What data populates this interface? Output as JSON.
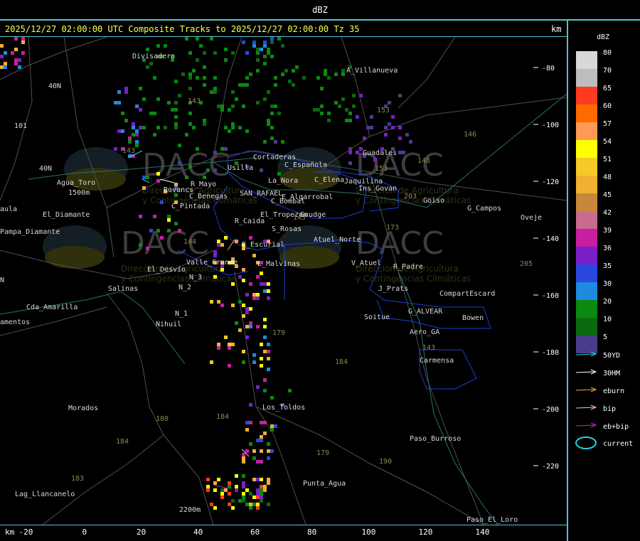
{
  "header": {
    "title": "dBZ"
  },
  "map_title": {
    "text": "2025/12/27 02:00:00 UTC Composite Tracks to 2025/12/27 02:00:00 Tz 35",
    "unit": "km"
  },
  "x_axis": {
    "unit": "km",
    "ticks": [
      "-20",
      "0",
      "20",
      "40",
      "60",
      "80",
      "100",
      "120",
      "140"
    ]
  },
  "y_axis": {
    "ticks": [
      "-80",
      "-100",
      "-120",
      "-140",
      "-160",
      "-180",
      "-200",
      "-220"
    ]
  },
  "legend": {
    "title": "dBZ",
    "scale": [
      {
        "value": "80",
        "color": "#d8d8d8"
      },
      {
        "value": "70",
        "color": "#bdbdbd"
      },
      {
        "value": "65",
        "color": "#ff3a1f"
      },
      {
        "value": "60",
        "color": "#ff6a00"
      },
      {
        "value": "57",
        "color": "#ff9a55"
      },
      {
        "value": "54",
        "color": "#ffff00"
      },
      {
        "value": "51",
        "color": "#f8c828"
      },
      {
        "value": "48",
        "color": "#f0b030"
      },
      {
        "value": "45",
        "color": "#c8883c"
      },
      {
        "value": "42",
        "color": "#c86b8f"
      },
      {
        "value": "39",
        "color": "#c81ea0"
      },
      {
        "value": "36",
        "color": "#7a20c8"
      },
      {
        "value": "35",
        "color": "#2a48e0"
      },
      {
        "value": "30",
        "color": "#1e8ae0"
      },
      {
        "value": "20",
        "color": "#0a8a10"
      },
      {
        "value": "10",
        "color": "#0b6a0e"
      },
      {
        "value": "5",
        "color": "#4a3c8c"
      }
    ],
    "tracks": [
      {
        "label": "50YD",
        "color": "#22d4e0"
      },
      {
        "label": "30HM",
        "color": "#ffffff"
      },
      {
        "label": "eburn",
        "color": "#f0b030"
      },
      {
        "label": "bip",
        "color": "#ffb8d8"
      },
      {
        "label": "eb+bip",
        "color": "#d020d0"
      }
    ],
    "current": {
      "label": "current",
      "color": "#22d4e0"
    }
  },
  "watermark": {
    "logo": "DACC",
    "line1": "Dirección de Agricultura",
    "line2": "y Contingencias Climáticas"
  },
  "places": [
    "Divisadero",
    "A_Villanueva",
    "40N",
    "101",
    "Agua_Toro",
    "1500m",
    "El_Diamante",
    "aula",
    "Pampa_Diamante",
    "40N",
    "Usilla",
    "Cortaderas",
    "C_Española",
    "C_Elena",
    "Jaquilina",
    "Ins_Govan",
    "Guadales",
    "Goiso",
    "G_Campos",
    "Oveje",
    "Rovancs",
    "R_Mayo",
    "C_Benegas",
    "SAN_RAFAEL",
    "La_Nora",
    "C_Bombal",
    "E_Algarrobal",
    "El_Tropezon",
    "Goudge",
    "C_Pintada",
    "R_Caida",
    "S_Rosas",
    "Atuel_Norte",
    "E_Escurial",
    "Valle_Grande",
    "L_Malvinas",
    "El_Desvio",
    "V_Atuel",
    "R_Padre",
    "N_3",
    "Salinas",
    "N_2",
    "J_Prats",
    "CompartEscard",
    "Cda_Amarilla",
    "N_1",
    "G_ALVEAR",
    "Soitue",
    "Bowen",
    "amentos",
    "Nihuil",
    "Aero_GA",
    "Carmensa",
    "Morados",
    "Los_Toldos",
    "Paso_Burroso",
    "Punta_Agua",
    "Lag_Llancanelo",
    "2200m",
    "Paso_El_Loro",
    "N"
  ],
  "route_numbers": [
    "143",
    "153",
    "143",
    "146",
    "148",
    "153",
    "203",
    "173",
    "144",
    "143",
    "179",
    "184",
    "180",
    "184",
    "184",
    "183",
    "190",
    "179",
    "143",
    "205"
  ]
}
